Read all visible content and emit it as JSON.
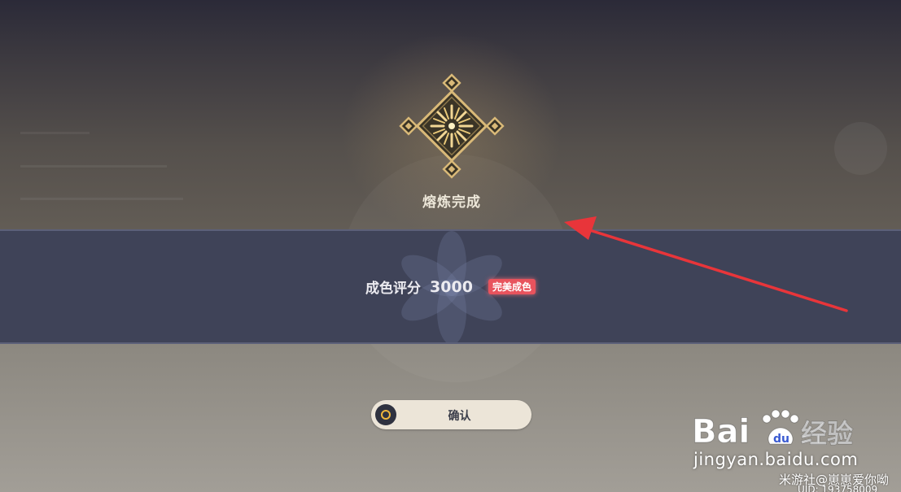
{
  "result": {
    "title": "熔炼完成",
    "icon": "firework-emblem-icon"
  },
  "score": {
    "label": "成色评分",
    "value": "3000",
    "badge": "完美成色"
  },
  "confirm": {
    "label": "确认",
    "icon": "confirm-circle-icon"
  },
  "annotation": {
    "color": "#e8353a"
  },
  "watermark": {
    "brand": "Baidu经验",
    "url": "jingyan.baidu.com",
    "user": "米游社@崽崽爱你呦",
    "uid": "UID: 193758009"
  },
  "colors": {
    "band": "#3f4358",
    "badge": "#e8535d",
    "button": "#ece5d8",
    "emblem_gold": "#d9b978"
  }
}
